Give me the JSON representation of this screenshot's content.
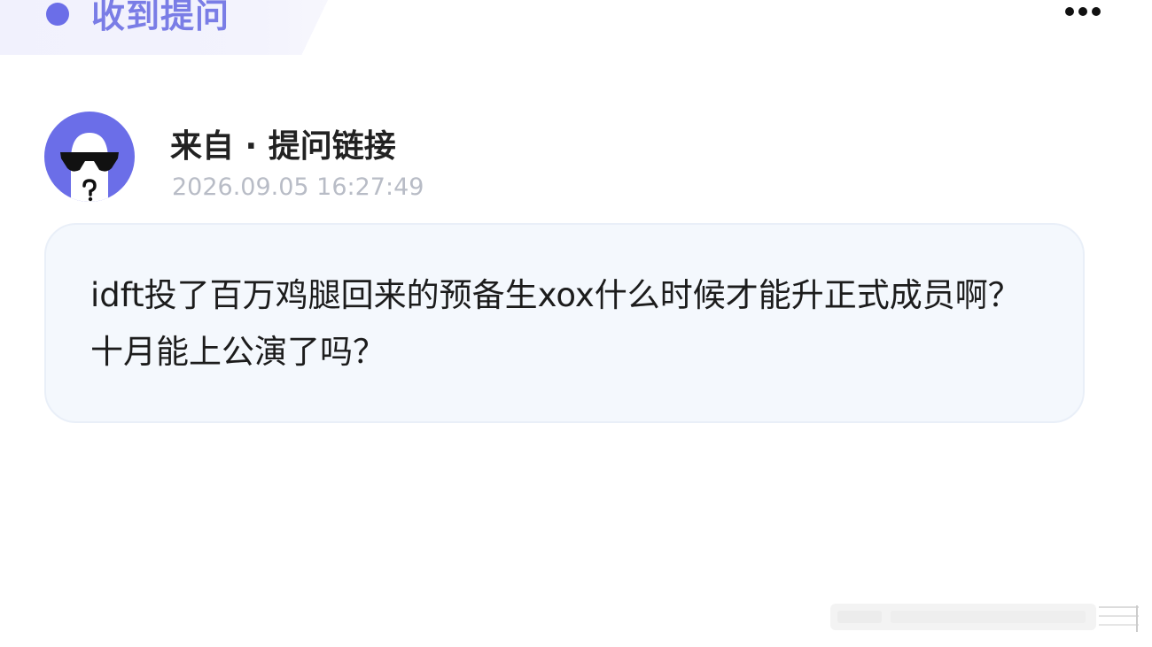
{
  "header": {
    "title": "收到提问",
    "accent_color": "#6b6ee8",
    "more_icon": "more-dots-icon"
  },
  "question": {
    "avatar_icon": "anonymous-sunglasses-avatar",
    "source": "来自 · 提问链接",
    "timestamp": "2026.09.05 16:27:49",
    "text": "idft投了百万鸡腿回来的预备生xox什么时候才能升正式成员啊？十月能上公演了吗？"
  }
}
